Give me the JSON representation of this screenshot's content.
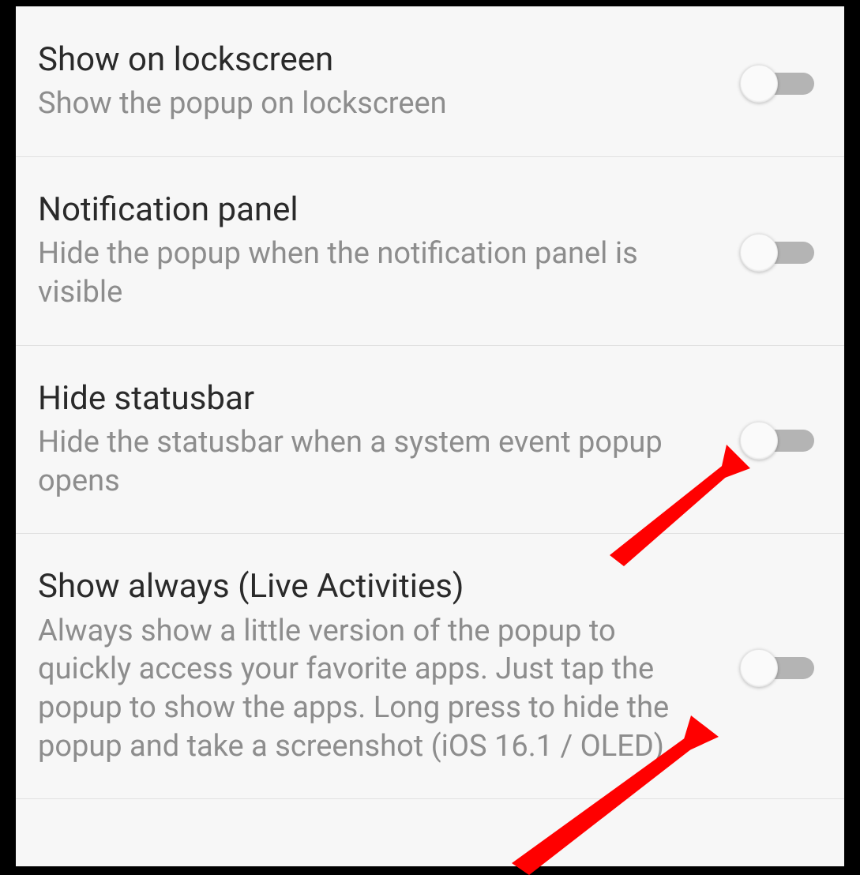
{
  "settings": [
    {
      "title": "Show on lockscreen",
      "desc": "Show the popup on lockscreen",
      "on": false
    },
    {
      "title": "Notification panel",
      "desc": "Hide the popup when the notification panel is visible",
      "on": false
    },
    {
      "title": "Hide statusbar",
      "desc": "Hide the statusbar when a system event popup opens",
      "on": false
    },
    {
      "title": "Show always (Live Activities)",
      "desc": "Always show a little version of the popup to quickly access your favorite apps. Just tap the popup to show the apps. Long press to hide the popup and take a screenshot (iOS 16.1 / OLED)",
      "on": false
    }
  ],
  "annotation_color": "#ff0000"
}
